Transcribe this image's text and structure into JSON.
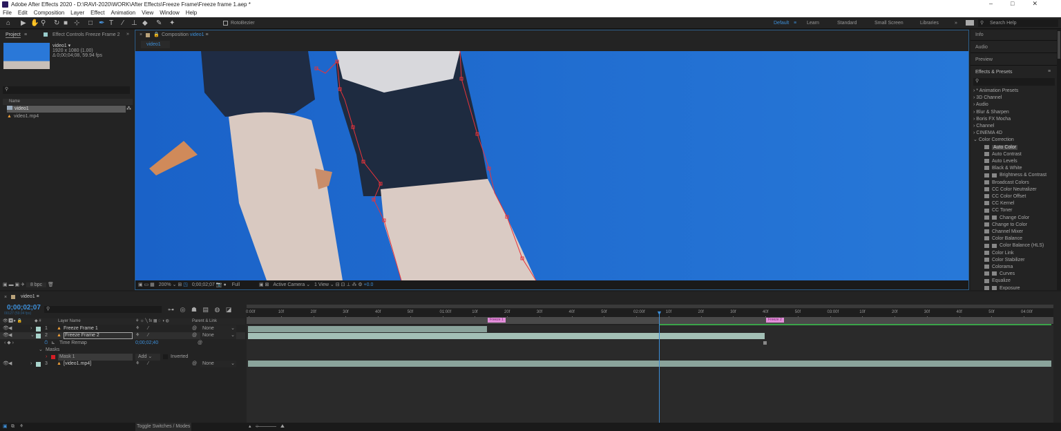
{
  "app": {
    "title": "Adobe After Effects 2020 - D:\\RAVI-2020\\WORK\\After Effects\\Freeze Frame\\Freeze frame 1.aep *",
    "window_controls": [
      "minimize",
      "restore",
      "close"
    ]
  },
  "menu": [
    "File",
    "Edit",
    "Composition",
    "Layer",
    "Effect",
    "Animation",
    "View",
    "Window",
    "Help"
  ],
  "toolbar": {
    "tools": [
      "home-icon",
      "selection-icon",
      "hand-icon",
      "zoom-icon",
      "rotate-icon",
      "camera-icon",
      "pan-behind-icon",
      "rectangle-icon",
      "pen-icon",
      "type-icon",
      "brush-icon",
      "clone-stamp-icon",
      "eraser-icon",
      "roto-brush-icon",
      "puppet-icon"
    ],
    "rotobezier": "RotoBezier",
    "workspaces": [
      "Default",
      "Learn",
      "Standard",
      "Small Screen",
      "Libraries"
    ],
    "active_workspace": "Default",
    "search_placeholder": "Search Help"
  },
  "project": {
    "tab": "Project",
    "effect_controls_tab": "Effect Controls Freeze Frame 2",
    "item_name": "video1 ▾",
    "item_size": "1920 x 1080 (1.00)",
    "item_duration": "Δ 0;00;04;08, 59.94 fps",
    "column_name": "Name",
    "items": [
      {
        "name": "video1",
        "type": "composition",
        "selected": true
      },
      {
        "name": "video1.mp4",
        "type": "footage"
      }
    ],
    "bpc": "8 bpc"
  },
  "composition": {
    "tab_label": "Composition",
    "comp_name": "video1",
    "sub_tab": "video1",
    "zoom": "200%",
    "timecode": "0;00;02;07",
    "resolution": "Full",
    "camera": "Active Camera",
    "views": "1 View",
    "exposure": "+0.0",
    "sky_color": "#1f6fd0",
    "mask_color": "#e8333a"
  },
  "right_panel": {
    "panels": [
      "Info",
      "Audio",
      "Preview"
    ],
    "effects_title": "Effects & Presets",
    "categories": [
      "* Animation Presets",
      "3D Channel",
      "Audio",
      "Blur & Sharpen",
      "Boris FX Mocha",
      "Channel",
      "CINEMA 4D"
    ],
    "open_category": "Color Correction",
    "effects": [
      "Auto Color",
      "Auto Contrast",
      "Auto Levels",
      "Black & White",
      "Brightness & Contrast",
      "Broadcast Colors",
      "CC Color Neutralizer",
      "CC Color Offset",
      "CC Kernel",
      "CC Toner",
      "Change Color",
      "Change to Color",
      "Channel Mixer",
      "Color Balance",
      "Color Balance (HLS)",
      "Color Link",
      "Color Stabilizer",
      "Colorama",
      "Curves",
      "Equalize",
      "Exposure"
    ],
    "selected_effect": "Auto Color"
  },
  "timeline": {
    "comp_tab": "video1",
    "timecode": "0;00;02;07",
    "frame_info": "00127 (59.94 fps)",
    "col_layer_name": "Layer Name",
    "col_parent": "Parent & Link",
    "layers": [
      {
        "num": "1",
        "name": "Freeze Frame 1",
        "parent": "None"
      },
      {
        "num": "2",
        "name": "Freeze Frame 2",
        "parent": "None"
      },
      {
        "num": "3",
        "name": "[video1.mp4]",
        "parent": "None"
      }
    ],
    "time_remap_label": "Time Remap",
    "time_remap_value": "0;00;02;40",
    "masks_label": "Masks",
    "mask_name": "Mask 1",
    "mask_mode": "Add",
    "mask_inverted": "Inverted",
    "ruler": [
      "0:00f",
      "10f",
      "20f",
      "30f",
      "40f",
      "50f",
      "01:00f",
      "10f",
      "20f",
      "30f",
      "40f",
      "50f",
      "02:00f",
      "10f",
      "20f",
      "30f",
      "40f",
      "50f",
      "03:00f",
      "10f",
      "20f",
      "30f",
      "40f",
      "50f",
      "04:00f"
    ],
    "markers": [
      "Freeze 1",
      "Freeze 2"
    ],
    "toggle_label": "Toggle Switches / Modes",
    "bar_color": "#8aa39b"
  }
}
